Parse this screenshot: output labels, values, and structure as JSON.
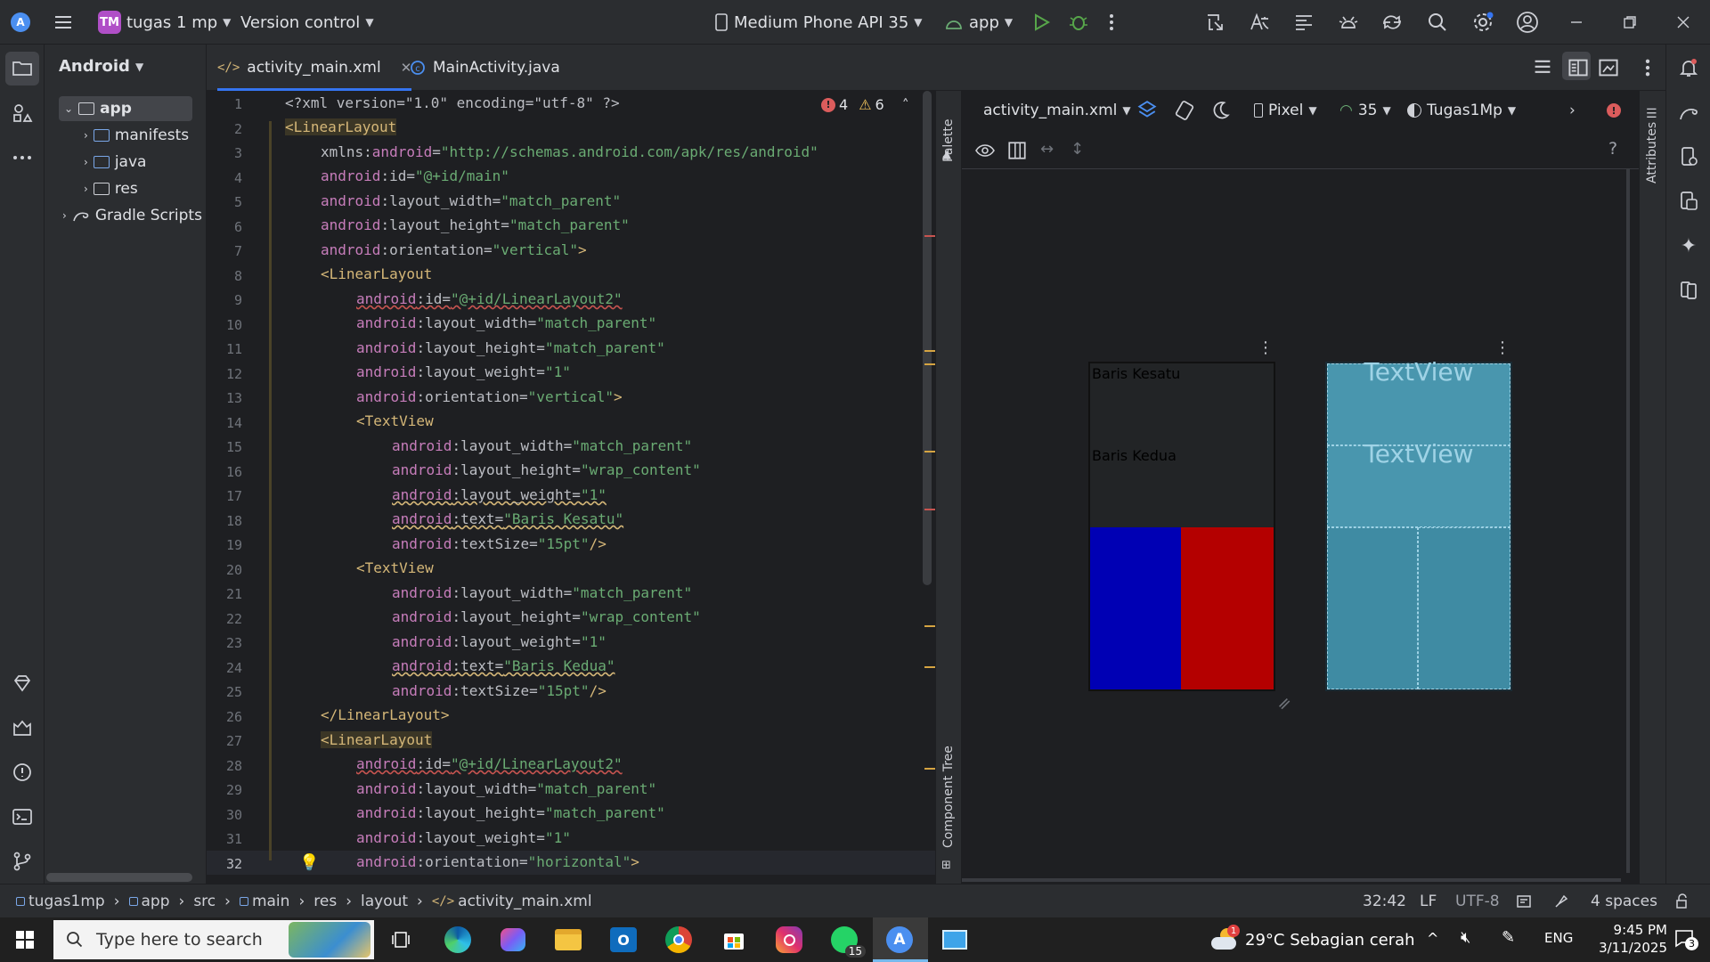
{
  "titlebar": {
    "project_badge": "TM",
    "project_name": "tugas 1 mp",
    "vcs": "Version control",
    "device": "Medium Phone API 35",
    "run_config": "app"
  },
  "project_panel": {
    "view": "Android",
    "items": [
      {
        "label": "app"
      },
      {
        "label": "manifests"
      },
      {
        "label": "java"
      },
      {
        "label": "res"
      },
      {
        "label": "Gradle Scripts"
      }
    ]
  },
  "tabs": [
    {
      "label": "activity_main.xml"
    },
    {
      "label": "MainActivity.java"
    }
  ],
  "inspections": {
    "errors": "4",
    "warnings": "6"
  },
  "code_lines": [
    {
      "n": "1"
    },
    {
      "n": "2"
    },
    {
      "n": "3"
    },
    {
      "n": "4"
    },
    {
      "n": "5"
    },
    {
      "n": "6"
    },
    {
      "n": "7"
    },
    {
      "n": "8"
    },
    {
      "n": "9"
    },
    {
      "n": "10"
    },
    {
      "n": "11"
    },
    {
      "n": "12"
    },
    {
      "n": "13"
    },
    {
      "n": "14"
    },
    {
      "n": "15"
    },
    {
      "n": "16"
    },
    {
      "n": "17"
    },
    {
      "n": "18"
    },
    {
      "n": "19"
    },
    {
      "n": "20"
    },
    {
      "n": "21"
    },
    {
      "n": "22"
    },
    {
      "n": "23"
    },
    {
      "n": "24"
    },
    {
      "n": "25"
    },
    {
      "n": "26"
    },
    {
      "n": "27"
    },
    {
      "n": "28"
    },
    {
      "n": "29"
    },
    {
      "n": "30"
    },
    {
      "n": "31"
    },
    {
      "n": "32"
    }
  ],
  "code": {
    "l1": "<?xml version=\"1.0\" encoding=\"utf-8\" ?>",
    "l2_tag": "<LinearLayout",
    "l3_a": "xmlns:",
    "l3_b": "android",
    "l3_c": "=",
    "l3_v": "\"http://schemas.android.com/apk/res/android\"",
    "l4_ns": "android",
    "l4_a": ":id=",
    "l4_v": "\"@+id/main\"",
    "l5_ns": "android",
    "l5_a": ":layout_width=",
    "l5_v": "\"match_parent\"",
    "l6_ns": "android",
    "l6_a": ":layout_height=",
    "l6_v": "\"match_parent\"",
    "l7_ns": "android",
    "l7_a": ":orientation=",
    "l7_v": "\"vertical\"",
    "l7_e": ">",
    "l8_tag": "<LinearLayout",
    "l9_ns": "android",
    "l9_a": ":id=",
    "l9_v": "\"@+id/LinearLayout2\"",
    "l10_ns": "android",
    "l10_a": ":layout_width=",
    "l10_v": "\"match_parent\"",
    "l11_ns": "android",
    "l11_a": ":layout_height=",
    "l11_v": "\"match_parent\"",
    "l12_ns": "android",
    "l12_a": ":layout_weight=",
    "l12_v": "\"1\"",
    "l13_ns": "android",
    "l13_a": ":orientation=",
    "l13_v": "\"vertical\"",
    "l13_e": ">",
    "l14_tag": "<TextView",
    "l15_ns": "android",
    "l15_a": ":layout_width=",
    "l15_v": "\"match_parent\"",
    "l16_ns": "android",
    "l16_a": ":layout_height=",
    "l16_v": "\"wrap_content\"",
    "l17_ns": "android",
    "l17_a": ":layout_weight=",
    "l17_v": "\"1\"",
    "l18_ns": "android",
    "l18_a": ":text=",
    "l18_v": "\"Baris Kesatu\"",
    "l19_ns": "android",
    "l19_a": ":textSize=",
    "l19_v": "\"15pt\"",
    "l19_e": "/>",
    "l20_tag": "<TextView",
    "l21_ns": "android",
    "l21_a": ":layout_width=",
    "l21_v": "\"match_parent\"",
    "l22_ns": "android",
    "l22_a": ":layout_height=",
    "l22_v": "\"wrap_content\"",
    "l23_ns": "android",
    "l23_a": ":layout_weight=",
    "l23_v": "\"1\"",
    "l24_ns": "android",
    "l24_a": ":text=",
    "l24_v": "\"Baris Kedua\"",
    "l25_ns": "android",
    "l25_a": ":textSize=",
    "l25_v": "\"15pt\"",
    "l25_e": "/>",
    "l26_tag": "</LinearLayout>",
    "l27_tag": "<LinearLayout",
    "l28_ns": "android",
    "l28_a": ":id=",
    "l28_v": "\"@+id/LinearLayout2\"",
    "l29_ns": "android",
    "l29_a": ":layout_width=",
    "l29_v": "\"match_parent\"",
    "l30_ns": "android",
    "l30_a": ":layout_height=",
    "l30_v": "\"match_parent\"",
    "l31_ns": "android",
    "l31_a": ":layout_weight=",
    "l31_v": "\"1\"",
    "l32_ns": "android",
    "l32_a": ":orientation=",
    "l32_v": "\"horizontal\"",
    "l32_e": ">"
  },
  "palette_label": "Palette",
  "component_tree_label": "Component Tree",
  "attributes_label": "Attributes",
  "design": {
    "file": "activity_main.xml",
    "device": "Pixel",
    "api": "35",
    "theme": "Tugas1Mp",
    "help": "?",
    "preview_text1": "Baris Kesatu",
    "preview_text2": "Baris Kedua",
    "blueprint_text1": "TextView",
    "blueprint_text2": "TextView",
    "blue_color": "#0000b4",
    "red_color": "#b40000"
  },
  "statusbar": {
    "crumbs": [
      "tugas1mp",
      "app",
      "src",
      "main",
      "res",
      "layout",
      "activity_main.xml"
    ],
    "position": "32:42",
    "line_sep": "LF",
    "encoding": "UTF-8",
    "indent": "4 spaces"
  },
  "taskbar": {
    "search_placeholder": "Type here to search",
    "whatsapp_badge": "15",
    "weather_badge": "1",
    "weather": "29°C  Sebagian cerah",
    "lang": "ENG",
    "time": "9:45 PM",
    "date": "3/11/2025",
    "notif_count": "3"
  }
}
